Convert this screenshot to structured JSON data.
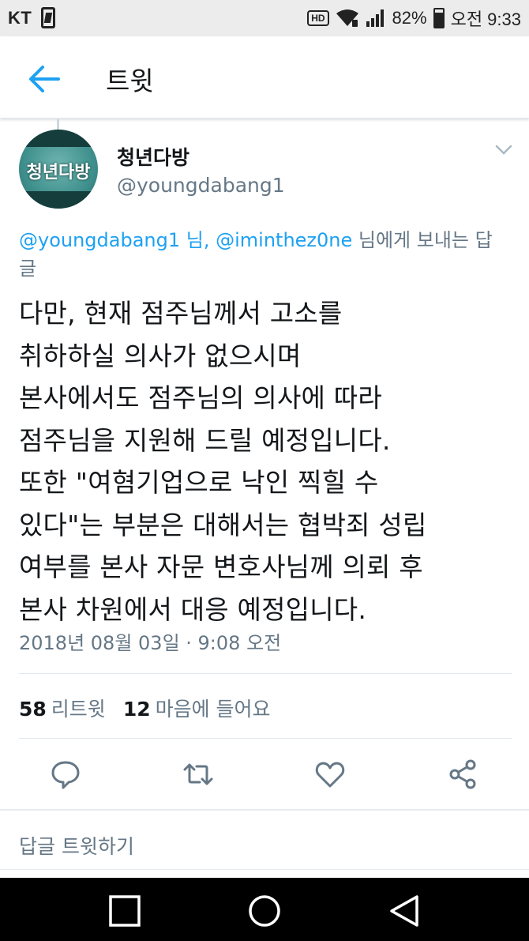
{
  "status_bar": {
    "carrier": "KT",
    "hd": "HD",
    "battery": "82%",
    "time": "오전 9:33"
  },
  "app_bar": {
    "title": "트윗"
  },
  "tweet": {
    "display_name": "청년다방",
    "username": "@youngdabang1",
    "avatar_text": "청년다방",
    "reply_to": {
      "mention1": "@youngdabang1",
      "sep1": " 님, ",
      "mention2": "@iminthez0ne",
      "suffix": " 님에게 보내는 답글"
    },
    "text": "다만, 현재 점주님께서 고소를\n취하하실 의사가 없으시며\n본사에서도 점주님의 의사에 따라\n점주님을 지원해 드릴 예정입니다.\n또한 \"여혐기업으로 낙인 찍힐 수\n있다\"는 부분은 대해서는 협박죄 성립\n여부를 본사 자문 변호사님께 의뢰 후\n본사 차원에서 대응 예정입니다.",
    "timestamp": "2018년 08월 03일 · 9:08 오전",
    "retweets": "58",
    "retweets_label": "리트윗",
    "likes": "12",
    "likes_label": "마음에 들어요"
  },
  "actions": [
    "reply-icon",
    "retweet-icon",
    "like-icon",
    "share-icon"
  ],
  "reply_box": {
    "placeholder": "답글 트윗하기"
  },
  "colors": {
    "accent": "#1da1f2",
    "secondary_text": "#657786",
    "primary_text": "#14171a"
  }
}
